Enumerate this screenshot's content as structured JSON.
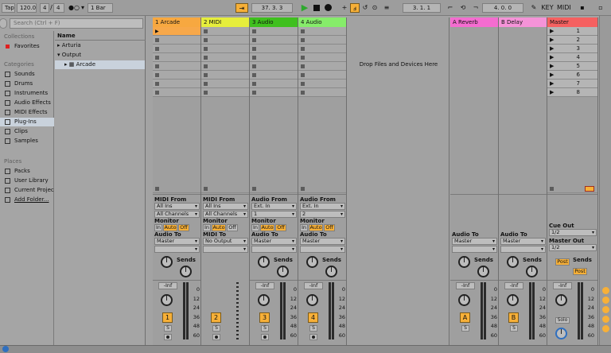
{
  "transport": {
    "tap": "Tap",
    "tempo": "120.00",
    "sig_num": "4",
    "sig_den": "4",
    "metro_icon": "●○",
    "quantize": "1 Bar",
    "position": "37.  3.  3",
    "loop_start": "3.  1.  1",
    "loop_len": "4.  0.  0"
  },
  "browser": {
    "search_placeholder": "Search (Ctrl + F)",
    "collections_title": "Collections",
    "favorites": "Favorites",
    "categories_title": "Categories",
    "categories": [
      "Sounds",
      "Drums",
      "Instruments",
      "Audio Effects",
      "MIDI Effects",
      "Plug-Ins",
      "Clips",
      "Samples"
    ],
    "places_title": "Places",
    "places": [
      "Packs",
      "User Library",
      "Current Projec",
      "Add Folder..."
    ],
    "name_header": "Name",
    "files": [
      "Arturia",
      "Output",
      "Arcade"
    ]
  },
  "tracks": [
    {
      "name": "1 Arcade",
      "color": "#f7a840",
      "in_label": "MIDI From",
      "in_src": "All Ins",
      "in_ch": "All Channels",
      "out": "Master",
      "num": "1"
    },
    {
      "name": "2 MIDI",
      "color": "#e6ee3c",
      "in_label": "MIDI From",
      "in_src": "All Ins",
      "in_ch": "All Channels",
      "out": "No Output",
      "num": "2"
    },
    {
      "name": "3 Audio",
      "color": "#3fc01e",
      "in_label": "Audio From",
      "in_src": "Ext. In",
      "in_ch": "1",
      "out": "Master",
      "num": "3"
    },
    {
      "name": "4 Audio",
      "color": "#86ec6a",
      "in_label": "Audio From",
      "in_src": "Ext. In",
      "in_ch": "2",
      "out": "Master",
      "num": "4"
    }
  ],
  "returns": [
    {
      "name": "A Reverb",
      "color": "#f46cd0",
      "out": "Master",
      "num": "A"
    },
    {
      "name": "B Delay",
      "color": "#f593d8",
      "out": "Master",
      "num": "B"
    }
  ],
  "master": {
    "name": "Master",
    "color": "#f56060",
    "scenes": [
      "1",
      "2",
      "3",
      "4",
      "5",
      "6",
      "7",
      "8"
    ],
    "cue_label": "Cue Out",
    "cue": "1/2",
    "master_out_label": "Master Out",
    "master_out": "1/2",
    "solo": "Solo",
    "post": "Post"
  },
  "labels": {
    "monitor": "Monitor",
    "audio_to": "Audio To",
    "midi_to": "MIDI To",
    "sends": "Sends",
    "in": "In",
    "auto": "Auto",
    "off": "Off",
    "inf": "-Inf",
    "s": "S",
    "drop": "Drop Files and Devices Here",
    "scale": [
      "0",
      "12",
      "24",
      "36",
      "48",
      "60"
    ]
  }
}
